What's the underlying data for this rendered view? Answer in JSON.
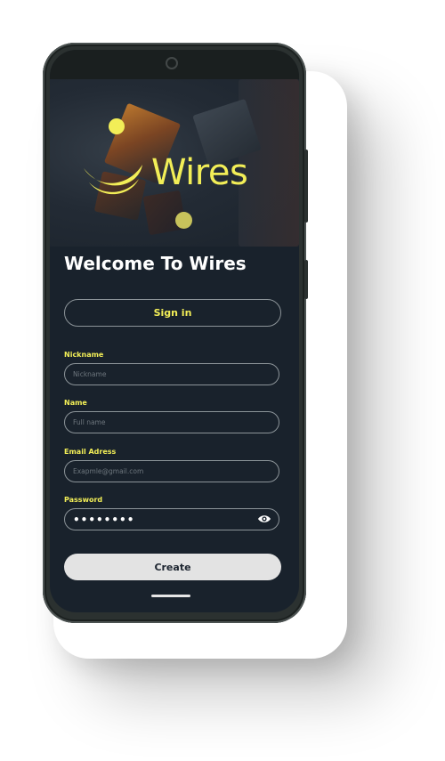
{
  "app": {
    "logo_text": "Wires",
    "brand_color": "#f2ee57",
    "background_color": "#19222c"
  },
  "header": {
    "title": "Welcome To Wires"
  },
  "buttons": {
    "signin_label": "Sign in",
    "create_label": "Create"
  },
  "form": {
    "nickname": {
      "label": "Nickname",
      "placeholder": "Nickname",
      "value": ""
    },
    "name": {
      "label": "Name",
      "placeholder": "Full name",
      "value": ""
    },
    "email": {
      "label": "Email Adress",
      "placeholder": "Exapmle@gmail.com",
      "value": ""
    },
    "password": {
      "label": "Password",
      "value": "••••••••",
      "toggle_icon": "eye-icon"
    }
  }
}
